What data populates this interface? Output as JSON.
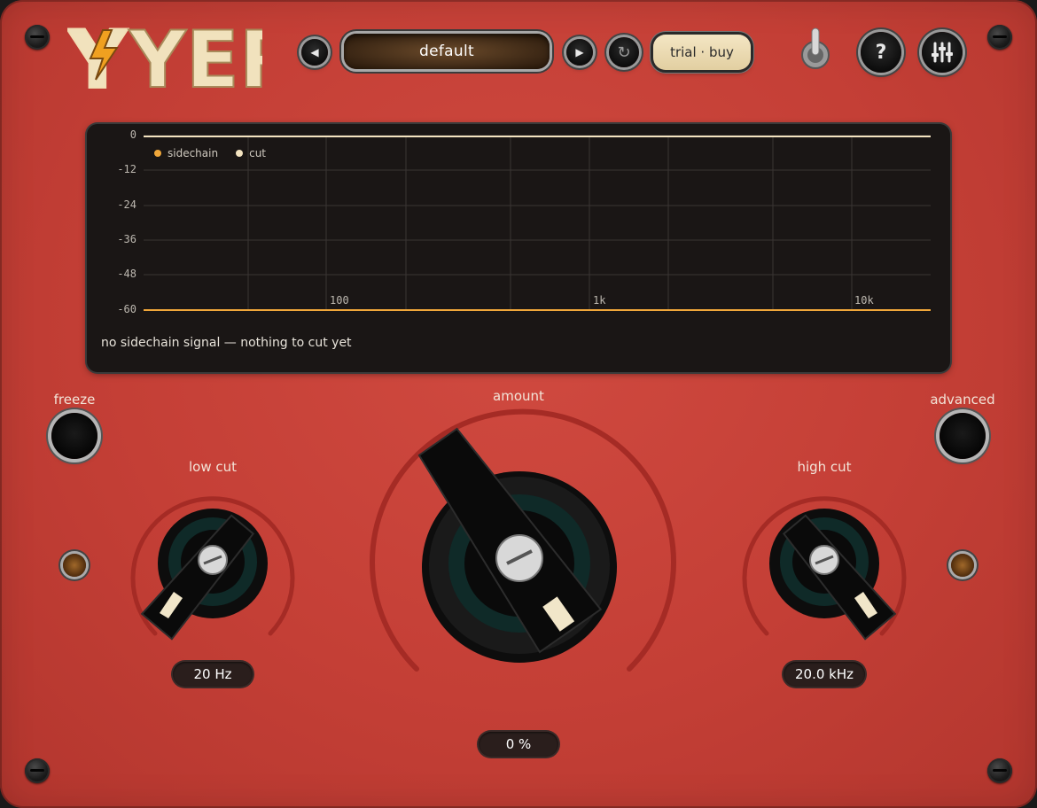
{
  "header": {
    "logo_text": "YER",
    "preset_name": "default",
    "prev_icon": "triangle-left-icon",
    "next_icon": "triangle-right-icon",
    "reload_icon": "refresh-icon",
    "trial_label": "trial · buy",
    "toggle_icon": "toggle-switch-icon",
    "help_label": "?",
    "settings_icon": "sliders-icon"
  },
  "analyzer": {
    "y_ticks": [
      "0",
      "-12",
      "-24",
      "-36",
      "-48",
      "-60"
    ],
    "x_ticks": [
      "100",
      "1k",
      "10k"
    ],
    "legend": [
      {
        "label": "sidechain",
        "color": "#f0a73a"
      },
      {
        "label": "cut",
        "color": "#f3e3c0"
      }
    ],
    "status_text": "no sidechain signal — nothing to cut yet"
  },
  "controls": {
    "freeze_label": "freeze",
    "advanced_label": "advanced",
    "amount": {
      "label": "amount",
      "value": "0 %"
    },
    "low_cut": {
      "label": "low cut",
      "value": "20 Hz"
    },
    "high_cut": {
      "label": "high cut",
      "value": "20.0 kHz"
    }
  },
  "colors": {
    "panel": "#c43f36",
    "accent_yellow": "#f0a73a",
    "cream": "#f3e3c0"
  }
}
